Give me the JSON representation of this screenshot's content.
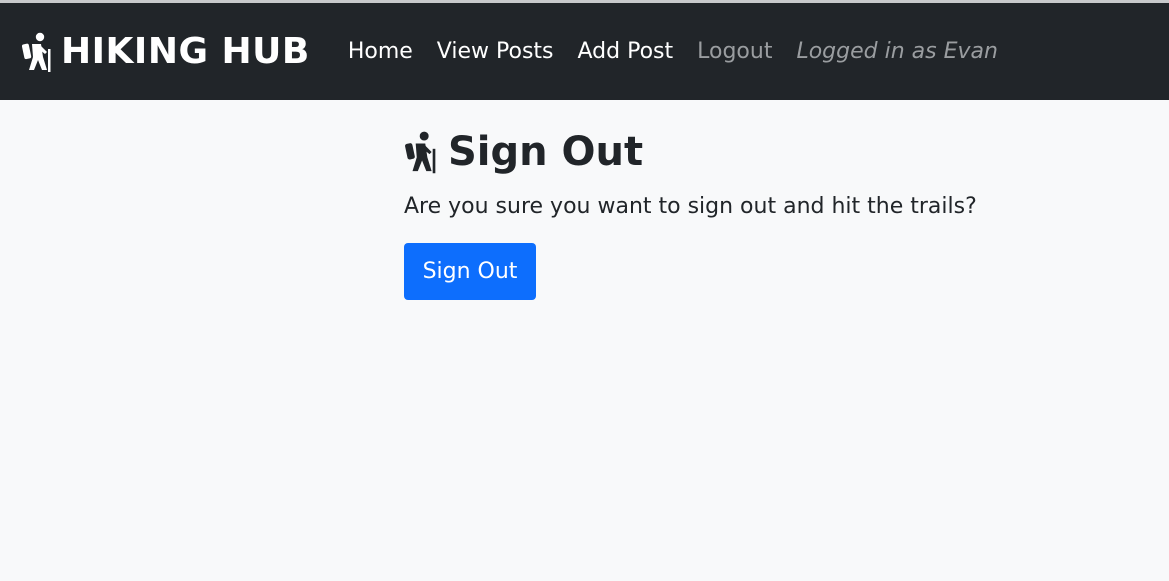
{
  "navbar": {
    "brand": "HIKING HUB",
    "brand_icon": "hiking-person-icon",
    "links": [
      "Home",
      "View Posts",
      "Add Post",
      "Logout"
    ],
    "logged_in_text": "Logged in as Evan"
  },
  "main": {
    "title": "Sign Out",
    "title_icon": "hiking-person-icon",
    "message": "Are you sure you want to sign out and hit the trails?",
    "button_label": "Sign Out"
  },
  "colors": {
    "navbar_bg": "#212529",
    "page_bg": "#f8f9fa",
    "primary": "#0d6efd",
    "muted_link": "#9a9da0"
  }
}
